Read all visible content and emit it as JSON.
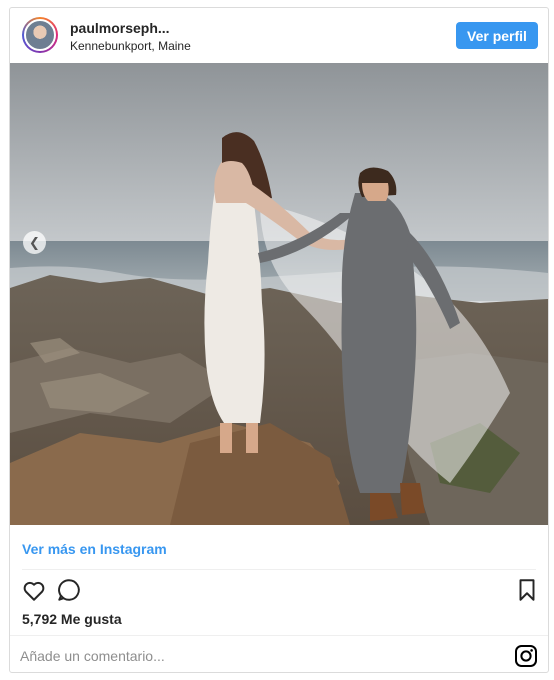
{
  "header": {
    "username": "paulmorseph...",
    "location": "Kennebunkport, Maine",
    "view_profile_label": "Ver perfil"
  },
  "post": {
    "view_more_label": "Ver más en Instagram",
    "likes_text": "5,792 Me gusta"
  },
  "comment": {
    "placeholder": "Añade un comentario..."
  },
  "icons": {
    "like": "heart-icon",
    "comment": "comment-icon",
    "save": "bookmark-icon",
    "brand": "instagram-icon",
    "carousel_prev": "chevron-left-icon"
  },
  "colors": {
    "accent": "#3897f0",
    "text": "#262626",
    "muted": "#8e8e8e",
    "border": "#dbdbdb"
  }
}
